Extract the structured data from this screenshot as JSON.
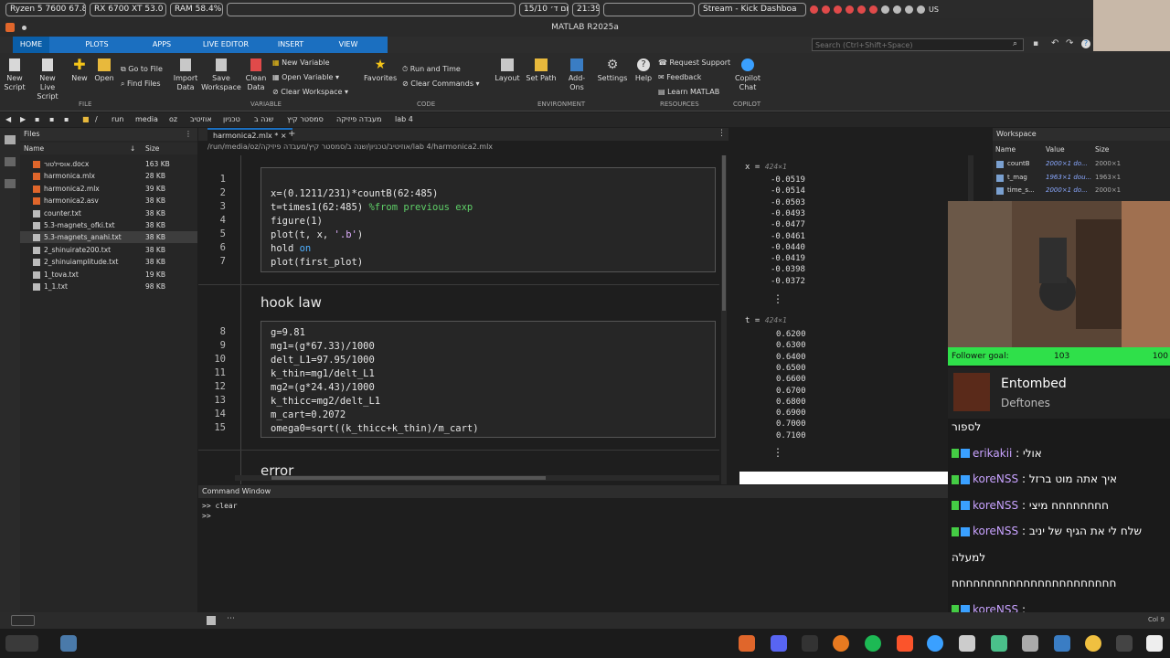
{
  "sysbar": {
    "cpu": "Ryzen 5 7600  67.8 °C",
    "gpu": "RX 6700 XT  53.0 °C",
    "ram": "RAM    58.4%",
    "date": "15/10 יום ד׳",
    "time": "21:39",
    "stream_tab": "Stream - Kick Dashboa",
    "lang": "US"
  },
  "window_title": "MATLAB R2025a",
  "top_tabs": [
    "HOME",
    "PLOTS",
    "APPS",
    "LIVE EDITOR",
    "INSERT",
    "VIEW"
  ],
  "search_placeholder": "Search (Ctrl+Shift+Space)",
  "ribbon": {
    "new_script": "New\nScript",
    "new_live_script": "New\nLive Script",
    "new": "New",
    "open": "Open",
    "go_to_file": "Go to File",
    "find_files": "Find Files",
    "import_data": "Import\nData",
    "save_workspace": "Save\nWorkspace",
    "clean_data": "Clean\nData",
    "new_variable": "New Variable",
    "open_variable": "Open Variable",
    "clear_workspace": "Clear Workspace",
    "favorites": "Favorites",
    "run_and_time": "Run and Time",
    "clear_commands": "Clear Commands",
    "layout": "Layout",
    "set_path": "Set Path",
    "add_ons": "Add-Ons",
    "settings": "Settings",
    "help": "Help",
    "request_support": "Request Support",
    "feedback": "Feedback",
    "learn_matlab": "Learn MATLAB",
    "copilot_chat": "Copilot\nChat",
    "groups": [
      "FILE",
      "VARIABLE",
      "CODE",
      "ENVIRONMENT",
      "RESOURCES",
      "COPILOT"
    ]
  },
  "path_crumbs": [
    "/",
    "run",
    "media",
    "oz",
    "אוזיטיב",
    "טכניון",
    "שנה ב",
    "סמסטר קיץ",
    "מעבדה פיזיקה",
    "lab 4"
  ],
  "files": {
    "title": "Files",
    "col_name": "Name",
    "col_size": "Size",
    "rows": [
      {
        "name": "אוסילטור.docx",
        "size": "163 KB"
      },
      {
        "name": "harmonica.mlx",
        "size": "28 KB"
      },
      {
        "name": "harmonica2.mlx",
        "size": "39 KB"
      },
      {
        "name": "harmonica2.asv",
        "size": "38 KB"
      },
      {
        "name": "counter.txt",
        "size": "38 KB"
      },
      {
        "name": "5.3-magnets_ofki.txt",
        "size": "38 KB"
      },
      {
        "name": "5.3-magnets_anahi.txt",
        "size": "38 KB"
      },
      {
        "name": "2_shinuirate200.txt",
        "size": "38 KB"
      },
      {
        "name": "2_shinuiamplitude.txt",
        "size": "38 KB"
      },
      {
        "name": "1_tova.txt",
        "size": "19 KB"
      },
      {
        "name": "1_1.txt",
        "size": "98 KB"
      }
    ]
  },
  "editor": {
    "tab": "harmonica2.mlx *",
    "path": "/run/media/oz/אוזיטיב/טכניון/שנה ב/סמסטר קיץ/מעבדה פיזיקה/lab 4/harmonica2.mlx",
    "heading_hook": "hook law",
    "heading_error": "error",
    "cell1_lines": [
      "1",
      "2",
      "3",
      "4",
      "5",
      "6",
      "7"
    ],
    "cell2_lines": [
      "8",
      "9",
      "10",
      "11",
      "12",
      "13",
      "14",
      "15"
    ]
  },
  "output": {
    "x_label": "x = ",
    "x_dim": "424×1",
    "x_values": [
      "-0.0519",
      "-0.0514",
      "-0.0503",
      "-0.0493",
      "-0.0477",
      "-0.0461",
      "-0.0440",
      "-0.0419",
      "-0.0398",
      "-0.0372"
    ],
    "t_label": "t = ",
    "t_dim": "424×1",
    "t_values": [
      "0.6200",
      "0.6300",
      "0.6400",
      "0.6500",
      "0.6600",
      "0.6700",
      "0.6800",
      "0.6900",
      "0.7000",
      "0.7100"
    ],
    "vellipsis": "⋮"
  },
  "workspace": {
    "title": "Workspace",
    "col_name": "Name",
    "col_value": "Value",
    "col_size": "Size",
    "rows": [
      {
        "name": "countB",
        "value": "2000×1 do...",
        "size": "2000×1"
      },
      {
        "name": "t_mag",
        "value": "1963×1 dou...",
        "size": "1963×1"
      },
      {
        "name": "time_s...",
        "value": "2000×1 do...",
        "size": "2000×1"
      }
    ]
  },
  "cmd": {
    "title": "Command Window",
    "line1": ">> clear",
    "line2": ">>"
  },
  "status_right": "Col 9",
  "overlay": {
    "follower_goal_label": "Follower goal:",
    "follower_goal_value": "103",
    "follower_goal_target": "100",
    "song_title": "Entombed",
    "song_artist": "Deftones",
    "chat": [
      {
        "user": "",
        "text": "לספור"
      },
      {
        "user": "erikakii",
        "text": "אולי"
      },
      {
        "user": "koreNSS",
        "text": "איך אתה מוט ברזל"
      },
      {
        "user": "koreNSS",
        "text": "חחחחחחחח מיצי"
      },
      {
        "user": "koreNSS",
        "text": "שלח לי את הגיף של יניב"
      },
      {
        "user": "",
        "text": "למעלה"
      },
      {
        "user": "",
        "text": "חחחחחחחחחחחחחחחחחחחחחחח"
      },
      {
        "user": "koreNSS",
        "text": ""
      },
      {
        "user": "",
        "text": "חחחחחחחחחחחחחחחחחחחחחחח"
      }
    ]
  }
}
